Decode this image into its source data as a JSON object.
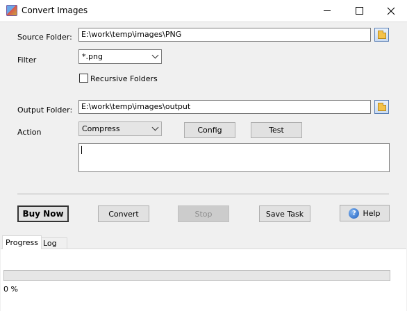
{
  "window": {
    "title": "Convert Images"
  },
  "form": {
    "source_folder_label": "Source Folder:",
    "source_folder_value": "E:\\work\\temp\\images\\PNG",
    "filter_label": "Filter",
    "filter_value": "*.png",
    "recursive_label": "Recursive Folders",
    "recursive_checked": false,
    "output_folder_label": "Output Folder:",
    "output_folder_value": "E:\\work\\temp\\images\\output",
    "action_label": "Action",
    "action_value": "Compress",
    "config_label": "Config",
    "test_label": "Test",
    "memo_value": ""
  },
  "buttons": {
    "buy_now": "Buy Now",
    "convert": "Convert",
    "stop": "Stop",
    "save_task": "Save Task",
    "help": "Help",
    "help_glyph": "?"
  },
  "tabs": [
    {
      "label": "Progress",
      "active": true
    },
    {
      "label": "Log",
      "active": false
    }
  ],
  "progress": {
    "value": 0,
    "text": "0 %"
  },
  "icons": {
    "app": "app-image-icon",
    "browse": "folder-icon",
    "help": "help-icon"
  }
}
